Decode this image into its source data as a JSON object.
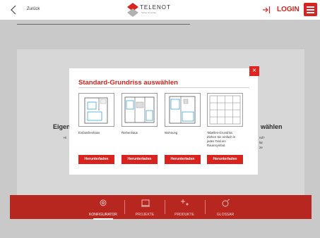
{
  "header": {
    "back_label": "Zurück",
    "logo_text": "TELENOT",
    "logo_subtext": "Sicher ist sicher.",
    "login_label": "LOGIN"
  },
  "background": {
    "title_left": "Eigen",
    "title_right": "wählen",
    "left_small": "Hi",
    "right_small": [
      "nd?",
      "lar",
      "ze"
    ]
  },
  "modal": {
    "title": "Standard-Grundriss auswählen",
    "close_glyph": "×",
    "plans": [
      {
        "label": "Einfamilienhaus",
        "button": "Herunterladen"
      },
      {
        "label": "Reihenhaus",
        "button": "Herunterladen"
      },
      {
        "label": "Wohnung",
        "button": "Herunterladen"
      },
      {
        "label_lines": [
          "Tabellen-Grundriss",
          "Ziehen Sie einfach in",
          "jedes Feld ein",
          "Raumsymbol."
        ],
        "button": "Herunterladen"
      }
    ]
  },
  "bottom_nav": {
    "items": [
      {
        "label": "KONFIGURATOR",
        "icon": "gear-icon",
        "active": true
      },
      {
        "label": "PROJEKTE",
        "icon": "folder-icon",
        "active": false
      },
      {
        "label": "PRODUKTE",
        "icon": "plus-products-icon",
        "active": false
      },
      {
        "label": "GLOSSAR",
        "icon": "glossary-icon",
        "active": false
      }
    ]
  },
  "colors": {
    "accent": "#d8231f",
    "nav_bg": "#b82620",
    "scene_bg": "#c9c9c9"
  }
}
